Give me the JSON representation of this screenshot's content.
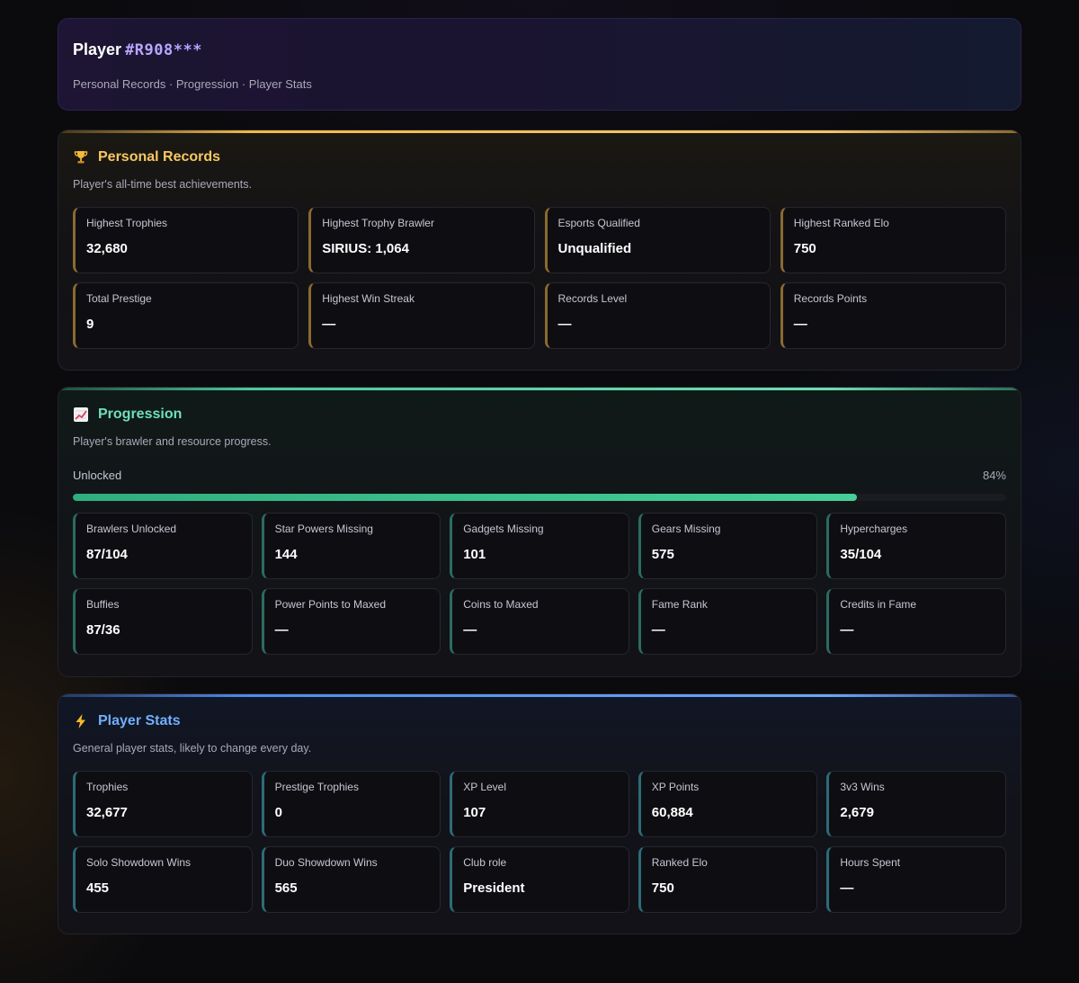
{
  "header": {
    "player_label": "Player",
    "player_tag": "#R908***",
    "subtitle": "Personal Records · Progression · Player Stats"
  },
  "records": {
    "icon": "trophy-icon",
    "title": "Personal Records",
    "description": "Player's all-time best achievements.",
    "accent": "#f2b84b",
    "cards": [
      {
        "label": "Highest Trophies",
        "value": "32,680"
      },
      {
        "label": "Highest Trophy Brawler",
        "value": "SIRIUS: 1,064"
      },
      {
        "label": "Esports Qualified",
        "value": "Unqualified"
      },
      {
        "label": "Highest Ranked Elo",
        "value": "750"
      },
      {
        "label": "Total Prestige",
        "value": "9"
      },
      {
        "label": "Highest Win Streak",
        "value": "—"
      },
      {
        "label": "Records Level",
        "value": "—"
      },
      {
        "label": "Records Points",
        "value": "—"
      }
    ]
  },
  "progression": {
    "icon": "chart-increasing-icon",
    "title": "Progression",
    "description": "Player's brawler and resource progress.",
    "accent": "#4cc99a",
    "bar": {
      "label": "Unlocked",
      "percent_text": "84%",
      "percent": 84
    },
    "cards": [
      {
        "label": "Brawlers Unlocked",
        "value": "87/104"
      },
      {
        "label": "Star Powers Missing",
        "value": "144"
      },
      {
        "label": "Gadgets Missing",
        "value": "101"
      },
      {
        "label": "Gears Missing",
        "value": "575"
      },
      {
        "label": "Hypercharges",
        "value": "35/104"
      },
      {
        "label": "Buffies",
        "value": "87/36"
      },
      {
        "label": "Power Points to Maxed",
        "value": "—"
      },
      {
        "label": "Coins to Maxed",
        "value": "—"
      },
      {
        "label": "Fame Rank",
        "value": "—"
      },
      {
        "label": "Credits in Fame",
        "value": "—"
      }
    ]
  },
  "stats": {
    "icon": "lightning-icon",
    "title": "Player Stats",
    "description": "General player stats, likely to change every day.",
    "accent": "#4f8de8",
    "cards": [
      {
        "label": "Trophies",
        "value": "32,677"
      },
      {
        "label": "Prestige Trophies",
        "value": "0"
      },
      {
        "label": "XP Level",
        "value": "107"
      },
      {
        "label": "XP Points",
        "value": "60,884"
      },
      {
        "label": "3v3 Wins",
        "value": "2,679"
      },
      {
        "label": "Solo Showdown Wins",
        "value": "455"
      },
      {
        "label": "Duo Showdown Wins",
        "value": "565"
      },
      {
        "label": "Club role",
        "value": "President"
      },
      {
        "label": "Ranked Elo",
        "value": "750"
      },
      {
        "label": "Hours Spent",
        "value": "—"
      }
    ]
  }
}
